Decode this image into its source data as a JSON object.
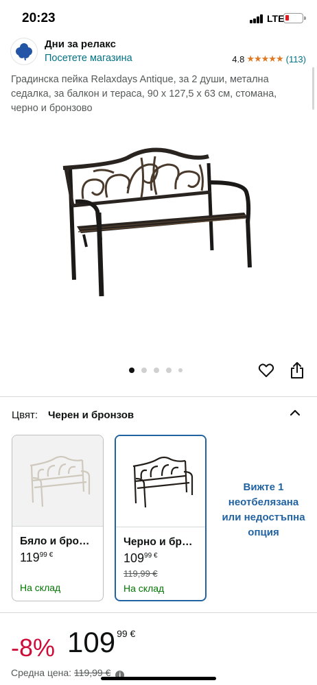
{
  "status_bar": {
    "time": "20:23",
    "network": "LTE"
  },
  "store": {
    "name": "Дни за релакс",
    "link": "Посетете магазина",
    "rating": "4.8",
    "stars": "★★★★★",
    "rating_count": "(113)",
    "logo_icon": "clover-icon"
  },
  "product": {
    "title": "Градинска пейка Relaxdays Antique, за 2 души, метална седалка, за балкон и тераса, 90 x 127,5 x 63 см, стомана, черно и бронзово",
    "image_count": 5,
    "active_image": 1
  },
  "color": {
    "label": "Цвят:",
    "value": "Черен и бронзов"
  },
  "variants": [
    {
      "name": "Бяло и бро…",
      "price_main": "119",
      "price_cents": "99",
      "currency": "€",
      "old_price": "",
      "stock": "На склад",
      "selected": false
    },
    {
      "name": "Черно и бр…",
      "price_main": "109",
      "price_cents": "99",
      "currency": "€",
      "old_price": "119,99 €",
      "stock": "На склад",
      "selected": true
    }
  ],
  "unavailable_text": "Вижте 1 неотбелязана или недостъпна опция",
  "pricing": {
    "discount": "-8%",
    "price_main": "109",
    "price_cents": "99",
    "currency": "€",
    "avg_label": "Средна цена:",
    "avg_price": "119,99 €"
  },
  "colors": {
    "link": "#007185",
    "accent_blue": "#2162a1",
    "discount_red": "#cc0c39",
    "stock_green": "#007600",
    "star_orange": "#de7921"
  }
}
